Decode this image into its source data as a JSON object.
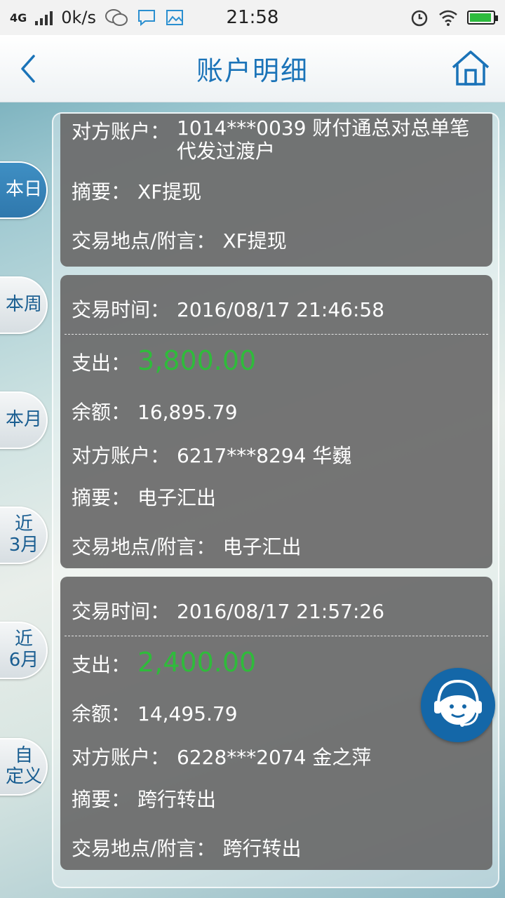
{
  "status_bar": {
    "network": "4G",
    "speed": "0k/s",
    "time": "21:58",
    "icons": [
      "signal-icon",
      "wechat-icon",
      "message-icon",
      "gallery-icon",
      "alarm-icon",
      "wifi-icon",
      "battery-icon"
    ],
    "battery_level": 0.95
  },
  "header": {
    "title": "账户明细"
  },
  "side_tabs": [
    {
      "label": "本日",
      "active": true
    },
    {
      "label": "本周",
      "active": false
    },
    {
      "label": "本月",
      "active": false
    },
    {
      "label": "近3月",
      "line1": "近",
      "line2": "3月",
      "active": false
    },
    {
      "label": "近6月",
      "line1": "近",
      "line2": "6月",
      "active": false
    },
    {
      "label": "自定义",
      "line1": "自",
      "line2": "定义",
      "active": false
    }
  ],
  "records": [
    {
      "counterparty_label": "对方账户：",
      "counterparty": "1014***0039 财付通总对总单笔代发过渡户",
      "summary_label": "摘要：",
      "summary": "XF提现",
      "place_label": "交易地点/附言：",
      "place": "XF提现"
    },
    {
      "time_label": "交易时间：",
      "time": "2016/08/17 21:46:58",
      "type_label": "支出：",
      "amount": "3,800.00",
      "balance_label": "余额：",
      "balance": "16,895.79",
      "counterparty_label": "对方账户：",
      "counterparty": "6217***8294 华巍",
      "summary_label": "摘要：",
      "summary": "电子汇出",
      "place_label": "交易地点/附言：",
      "place": "电子汇出"
    },
    {
      "time_label": "交易时间：",
      "time": "2016/08/17 21:57:26",
      "type_label": "支出：",
      "amount": "2,400.00",
      "balance_label": "余额：",
      "balance": "14,495.79",
      "counterparty_label": "对方账户：",
      "counterparty": "6228***2074 金之萍",
      "summary_label": "摘要：",
      "summary": "跨行转出",
      "place_label": "交易地点/附言：",
      "place": "跨行转出"
    }
  ],
  "colors": {
    "accent": "#1a73b8",
    "amount_green": "#2fbb3b",
    "card_bg": "#696969",
    "active_tab": "#3f8fc3"
  }
}
